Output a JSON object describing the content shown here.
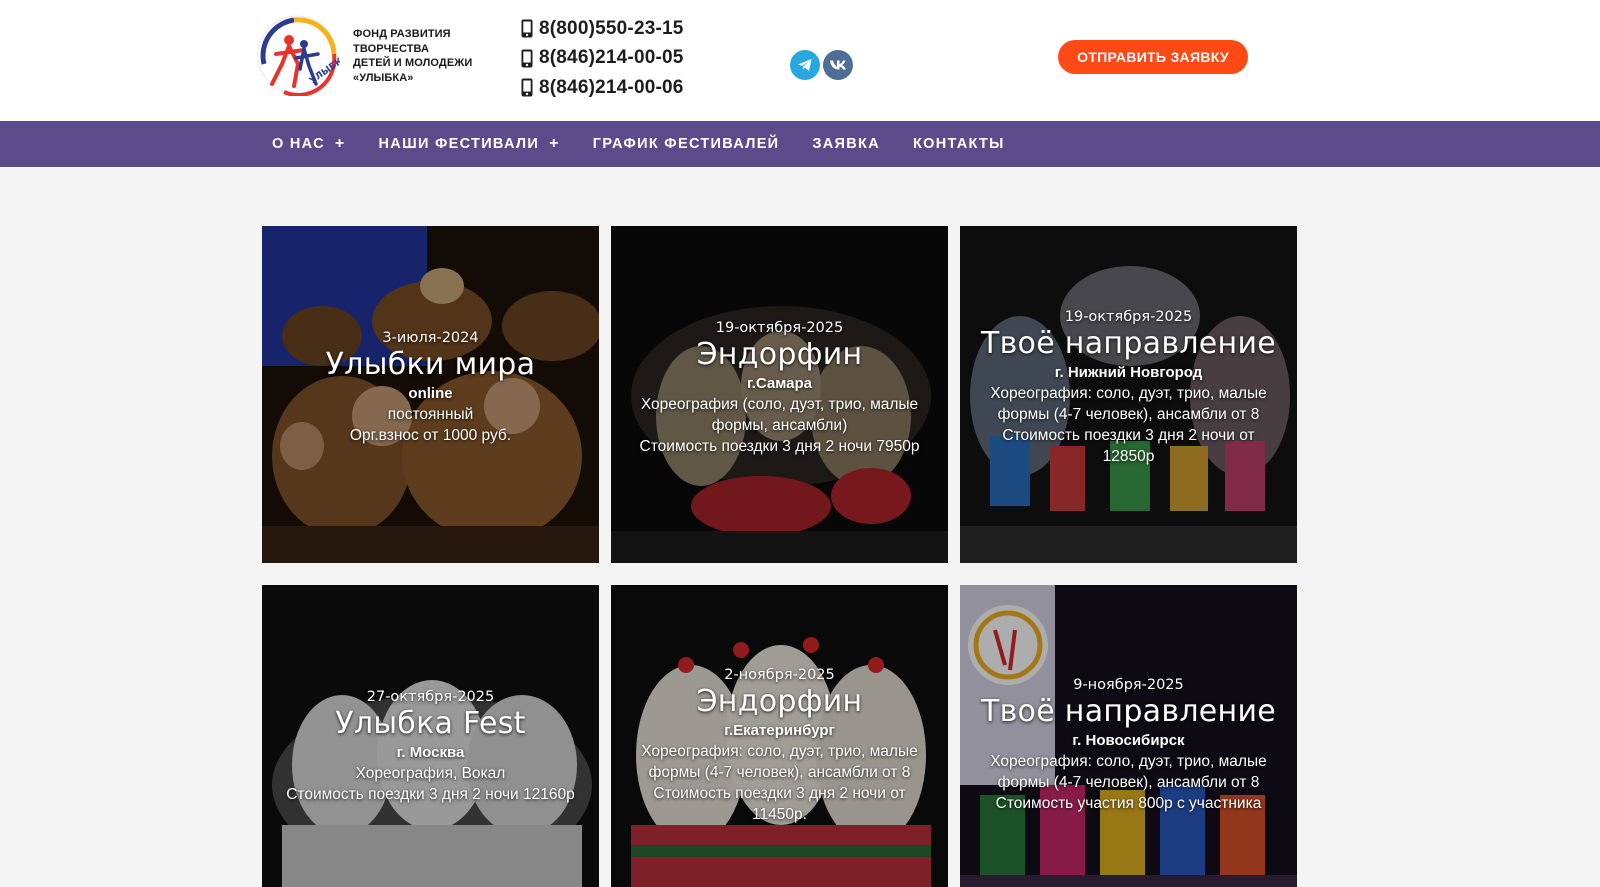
{
  "header": {
    "logo_lines": [
      "ФОНД РАЗВИТИЯ",
      "ТВОРЧЕСТВА",
      "ДЕТЕЙ И МОЛОДЕЖИ",
      "«УЛЫБКА»"
    ],
    "logo_badge": "УЛЫБКА",
    "phones": [
      "8(800)550-23-15",
      "8(846)214-00-05",
      "8(846)214-00-06"
    ],
    "socials": [
      "telegram-icon",
      "vk-icon"
    ],
    "cta_label": "ОТПРАВИТЬ ЗАЯВКУ"
  },
  "nav": {
    "items": [
      {
        "label": "О НАС",
        "plus": "+"
      },
      {
        "label": "НАШИ ФЕСТИВАЛИ",
        "plus": "+"
      },
      {
        "label": "ГРАФИК ФЕСТИВАЛЕЙ",
        "plus": ""
      },
      {
        "label": "ЗАЯВКА",
        "plus": ""
      },
      {
        "label": "КОНТАКТЫ",
        "plus": ""
      }
    ]
  },
  "cards": [
    {
      "date": "3-июля-2024",
      "title": "Улыбки мира",
      "city": "online",
      "lines": [
        "постоянный",
        "Орг.взнос от 1000 руб."
      ]
    },
    {
      "date": "19-октября-2025",
      "title": "Эндорфин",
      "city": "г.Самара",
      "lines": [
        "Хореография (соло, дуэт, трио, малые",
        "формы, ансамбли)",
        "Стоимость поездки 3 дня 2 ночи 7950р"
      ]
    },
    {
      "date": "19-октября-2025",
      "title": "Твоё направление",
      "city": "г. Нижний Новгород",
      "lines": [
        "Хореография: соло, дуэт, трио, малые",
        "формы (4-7 человек), ансамбли от 8",
        "Стоимость поездки 3 дня 2 ночи от",
        "12850р"
      ]
    },
    {
      "date": "27-октября-2025",
      "title": "Улыбка Fest",
      "city": "г. Москва",
      "lines": [
        "Хореография, Вокал",
        "Стоимость поездки 3 дня 2 ночи 12160р"
      ]
    },
    {
      "date": "2-ноября-2025",
      "title": "Эндорфин",
      "city": "г.Екатеринбург",
      "lines": [
        "Хореография: соло, дуэт, трио, малые",
        "формы (4-7 человек), ансамбли от 8",
        "Стоимость поездки 3 дня 2 ночи от",
        "11450р."
      ]
    },
    {
      "date": "9-ноября-2025",
      "title": "Твоё направление",
      "city": "г. Новосибирск",
      "lines": [
        "Хореография: соло, дуэт, трио, малые",
        "формы (4-7 человек), ансамбли от 8",
        "Стоимость участия 800р с участника"
      ]
    }
  ]
}
